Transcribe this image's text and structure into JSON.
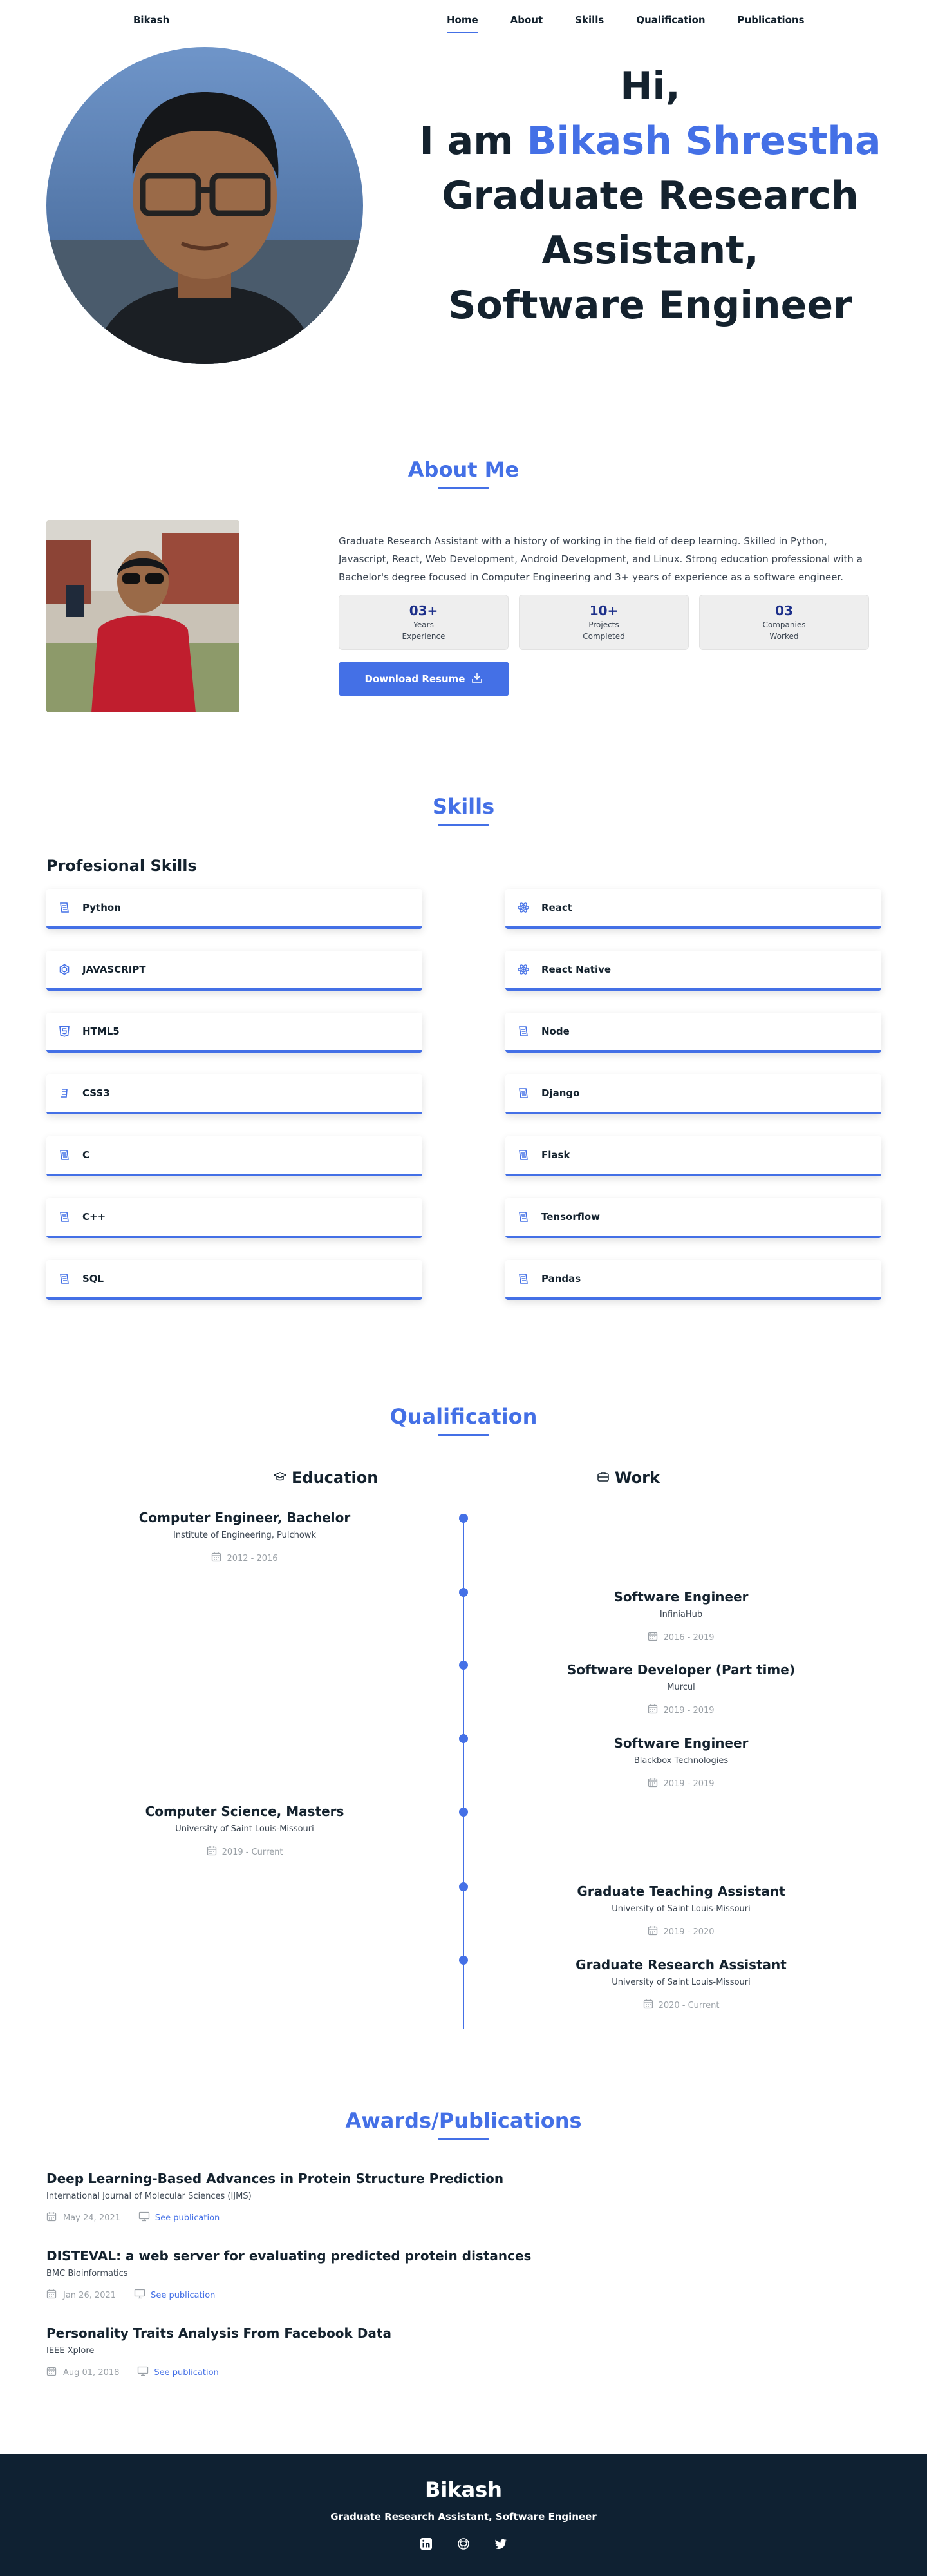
{
  "nav": {
    "brand": "Bikash",
    "items": [
      "Home",
      "About",
      "Skills",
      "Qualification",
      "Publications"
    ],
    "active": "Home"
  },
  "hero": {
    "line1": "Hi,",
    "line2_prefix": "I am ",
    "line2_name": "Bikash Shrestha",
    "line3": "Graduate Research",
    "line4": "Assistant,",
    "line5": "Software Engineer"
  },
  "about": {
    "title": "About Me",
    "text": "Graduate Research Assistant with a history of working in the field of deep learning. Skilled in Python, Javascript, React, Web Development, Android Development, and Linux. Strong education professional with a Bachelor's degree focused in Computer Engineering and 3+ years of experience as a software engineer.",
    "stats": [
      {
        "num": "03+",
        "line1": "Years",
        "line2": "Experience"
      },
      {
        "num": "10+",
        "line1": "Projects",
        "line2": "Completed"
      },
      {
        "num": "03",
        "line1": "Companies",
        "line2": "Worked"
      }
    ],
    "resume_button": "Download Resume"
  },
  "skills": {
    "title": "Skills",
    "subtitle": "Profesional Skills",
    "left": [
      {
        "name": "Python",
        "icon": "scroll-icon"
      },
      {
        "name": "JAVASCRIPT",
        "icon": "hexagon-icon"
      },
      {
        "name": "HTML5",
        "icon": "html5-icon"
      },
      {
        "name": "CSS3",
        "icon": "css3-icon"
      },
      {
        "name": "C",
        "icon": "scroll-icon"
      },
      {
        "name": "C++",
        "icon": "scroll-icon"
      },
      {
        "name": "SQL",
        "icon": "scroll-icon"
      }
    ],
    "right": [
      {
        "name": "React",
        "icon": "atom-icon"
      },
      {
        "name": "React Native",
        "icon": "atom-icon"
      },
      {
        "name": "Node",
        "icon": "scroll-icon"
      },
      {
        "name": "Django",
        "icon": "scroll-icon"
      },
      {
        "name": "Flask",
        "icon": "scroll-icon"
      },
      {
        "name": "Tensorflow",
        "icon": "scroll-icon"
      },
      {
        "name": "Pandas",
        "icon": "scroll-icon"
      }
    ]
  },
  "qualification": {
    "title": "Qualification",
    "education_label": "Education",
    "work_label": "Work",
    "items": [
      {
        "side": "left",
        "title": "Computer Engineer, Bachelor",
        "org": "Institute of Engineering, Pulchowk",
        "date": "2012 - 2016"
      },
      {
        "side": "right",
        "title": "Software Engineer",
        "org": "InfiniaHub",
        "date": "2016 - 2019"
      },
      {
        "side": "right",
        "title": "Software Developer (Part time)",
        "org": "Murcul",
        "date": "2019 - 2019"
      },
      {
        "side": "right",
        "title": "Software Engineer",
        "org": "Blackbox Technologies",
        "date": "2019 - 2019"
      },
      {
        "side": "left",
        "title": "Computer Science, Masters",
        "org": "University of Saint Louis-Missouri",
        "date": "2019 - Current"
      },
      {
        "side": "right",
        "title": "Graduate Teaching Assistant",
        "org": "University of Saint Louis-Missouri",
        "date": "2019 - 2020"
      },
      {
        "side": "right",
        "title": "Graduate Research Assistant",
        "org": "University of Saint Louis-Missouri",
        "date": "2020 - Current"
      }
    ]
  },
  "publications": {
    "title": "Awards/Publications",
    "items": [
      {
        "title": "Deep Learning-Based Advances in Protein Structure Prediction",
        "journal": "International Journal of Molecular Sciences (IJMS)",
        "date": "May 24, 2021",
        "link": "See publication"
      },
      {
        "title": "DISTEVAL: a web server for evaluating predicted protein distances",
        "journal": "BMC Bioinformatics",
        "date": "Jan 26, 2021",
        "link": "See publication"
      },
      {
        "title": "Personality Traits Analysis From Facebook Data",
        "journal": "IEEE Xplore",
        "date": "Aug 01, 2018",
        "link": "See publication"
      }
    ]
  },
  "footer": {
    "name": "Bikash",
    "role": "Graduate Research Assistant, Software Engineer",
    "socials": [
      "linkedin-icon",
      "github-icon",
      "twitter-icon"
    ]
  },
  "colors": {
    "accent": "#4470e6",
    "dark": "#14222e",
    "footer_bg": "#0f2132"
  }
}
